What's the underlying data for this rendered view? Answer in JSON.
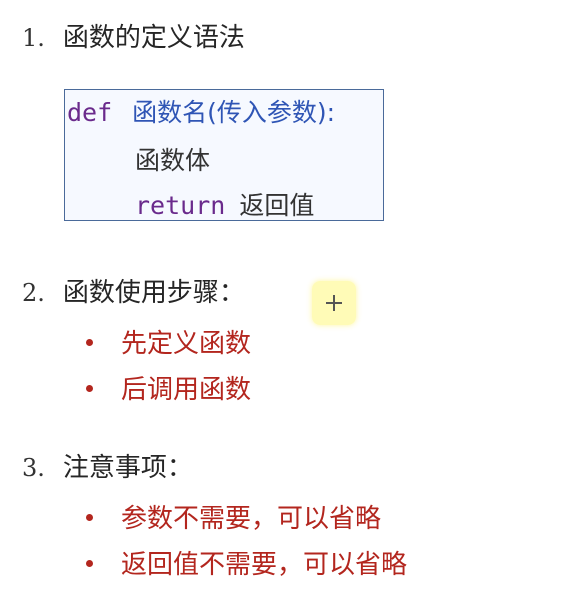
{
  "sections": [
    {
      "number": "1.",
      "title": "函数的定义语法"
    },
    {
      "number": "2.",
      "title": "函数使用步骤："
    },
    {
      "number": "3.",
      "title": "注意事项："
    }
  ],
  "code": {
    "line1": {
      "keyword": "def",
      "signature": "函数名(传入参数):"
    },
    "line2": {
      "body": "函数体"
    },
    "line3": {
      "keyword": "return",
      "value": "返回值"
    }
  },
  "steps": [
    "先定义函数",
    "后调用函数"
  ],
  "notes": [
    "参数不需要，可以省略",
    "返回值不需要，可以省略"
  ],
  "colors": {
    "keyword": "#6a2a8c",
    "function_name": "#2f55b5",
    "bullet_text": "#b3261e",
    "code_border": "#4a6a9a"
  },
  "icons": {
    "cursor": "crosshair-cursor-icon"
  }
}
